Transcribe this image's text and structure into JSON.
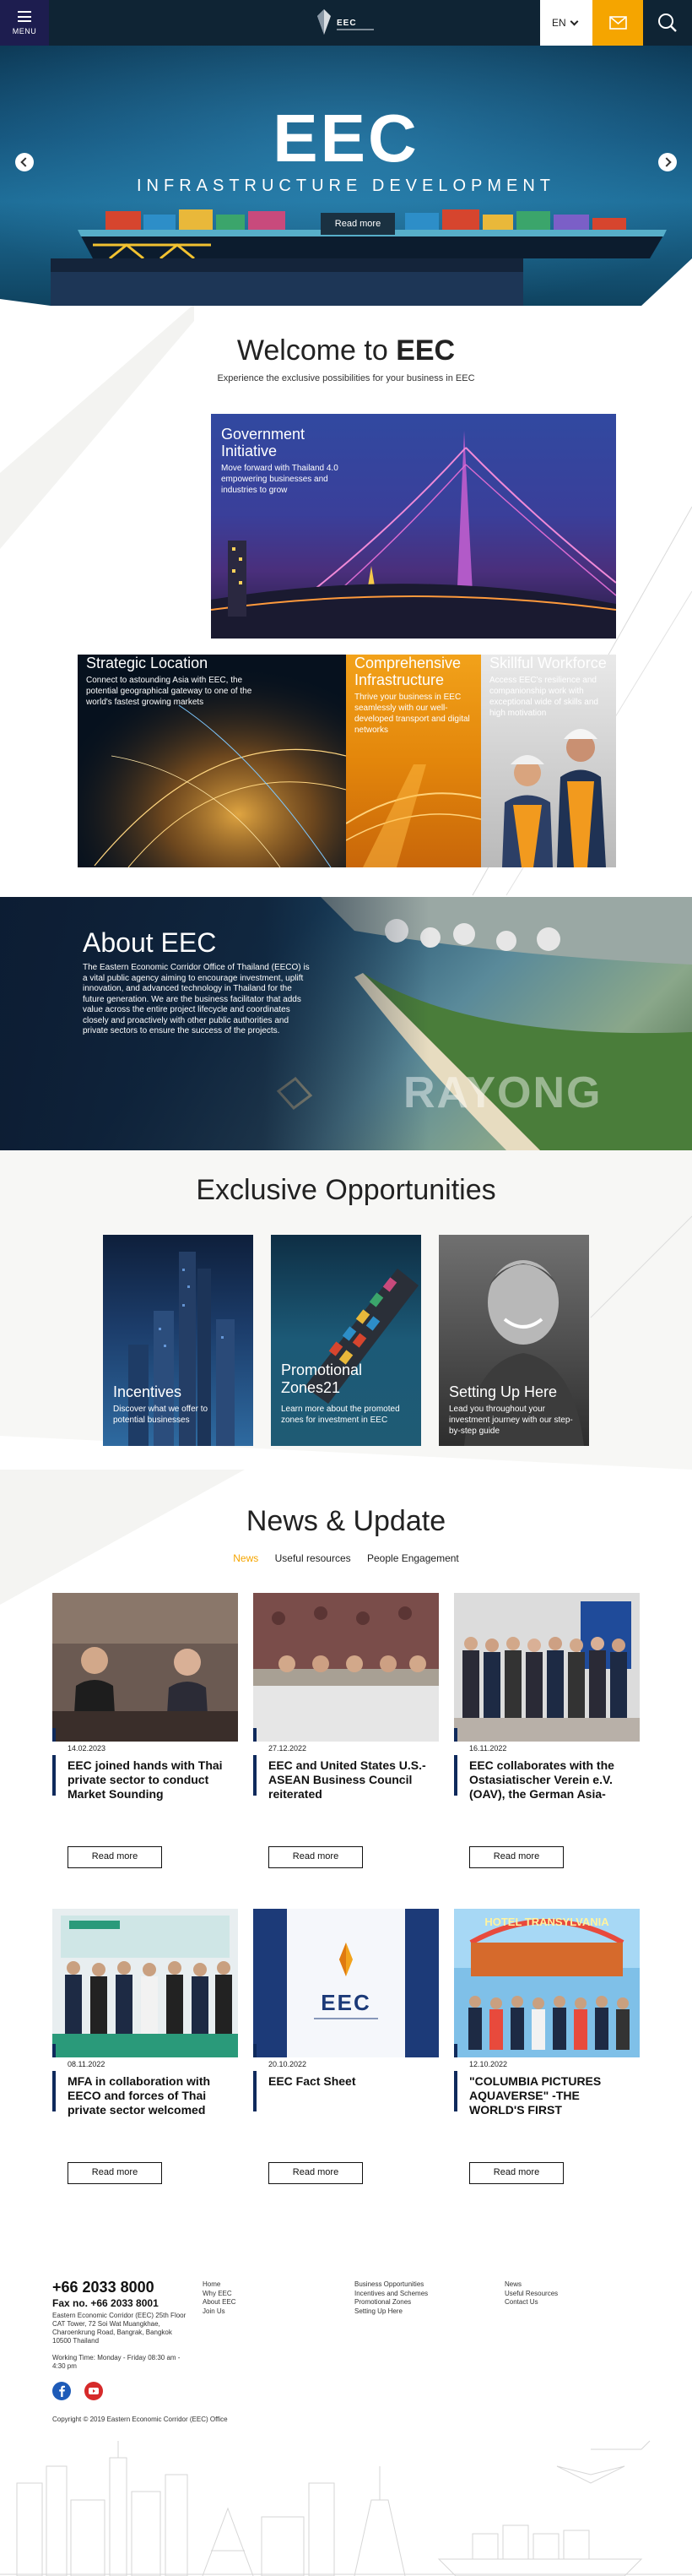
{
  "header": {
    "menu_label": "MENU",
    "logo_text": "EEC",
    "lang": "EN"
  },
  "hero": {
    "title": "EEC",
    "subtitle": "INFRASTRUCTURE DEVELOPMENT",
    "button": "Read more"
  },
  "welcome": {
    "title_plain": "Welcome to ",
    "title_bold": "EEC",
    "subtitle": "Experience the exclusive possibilities for your business in EEC"
  },
  "tiles": {
    "government": {
      "title": "Government Initiative",
      "text": "Move forward with Thailand 4.0 empowering businesses and industries to grow"
    },
    "strategic": {
      "title": "Strategic Location",
      "text": "Connect to astounding Asia with EEC, the potential geographical gateway to one of the world's fastest growing markets"
    },
    "comprehensive": {
      "title": "Comprehensive Infrastructure",
      "text": "Thrive your business in EEC seamlessly with our well-developed transport and digital networks"
    },
    "skillful": {
      "title": "Skillful Workforce",
      "text": "Access EEC's resilience and companionship work with exceptional wide of skills and high motivation"
    }
  },
  "about": {
    "title": "About EEC",
    "text": "The Eastern Economic Corridor Office of Thailand (EECO) is a vital public agency aiming to encourage investment, uplift innovation, and advanced technology in Thailand for the future generation. We are the business facilitator that adds value across the entire project lifecycle and coordinates closely and proactively with other public authorities and private sectors to ensure the success of the projects.",
    "watermark": "RAYONG"
  },
  "exclusive": {
    "title_plain": "Exclusive ",
    "title_bold": "Opportunities",
    "cards": [
      {
        "title": "Incentives",
        "text": "Discover what we offer to potential businesses"
      },
      {
        "title": "Promotional Zones21",
        "text": "Learn more about the promoted zones for investment in EEC"
      },
      {
        "title": "Setting Up Here",
        "text": "Lead you throughout your investment journey with our step-by-step guide"
      }
    ]
  },
  "news": {
    "title_plain": "News & ",
    "title_bold": "Update",
    "tabs": [
      "News",
      "Useful resources",
      "People Engagement"
    ],
    "button": "Read more",
    "items": [
      {
        "date": "14.02.2023",
        "headline": "EEC joined hands with Thai private sector to conduct Market Sounding"
      },
      {
        "date": "27.12.2022",
        "headline": "EEC and United States U.S.-ASEAN Business Council reiterated"
      },
      {
        "date": "16.11.2022",
        "headline": "EEC collaborates with the Ostasiatischer Verein e.V. (OAV), the German Asia-"
      },
      {
        "date": "08.11.2022",
        "headline": "MFA in collaboration with EECO and forces of Thai private sector welcomed"
      },
      {
        "date": "20.10.2022",
        "headline": "EEC Fact Sheet"
      },
      {
        "date": "12.10.2022",
        "headline": "\"COLUMBIA PICTURES AQUAVERSE\" -THE WORLD'S FIRST"
      }
    ],
    "factsheet_logo": "EEC",
    "hotel_sign": "HOTEL TRANSYLVANIA"
  },
  "footer": {
    "phone": "+66 2033 8000",
    "fax": "Fax no. +66 2033 8001",
    "address": "Eastern Economic Corridor (EEC) 25th Floor CAT Tower, 72 Soi Wat Muangkhae, Charoenkrung Road, Bangrak, Bangkok 10500 Thailand",
    "hours": "Working Time: Monday - Friday 08:30 am - 4:30 pm",
    "col1": [
      "Home",
      "Why EEC",
      "About EEC",
      "Join Us"
    ],
    "col2": [
      "Business Opportunities",
      "Incentives and Schemes",
      "Promotional Zones",
      "Setting Up Here"
    ],
    "col3": [
      "News",
      "Useful Resources",
      "Contact Us"
    ],
    "copyright": "Copyright © 2019 Eastern Economic Corridor (EEC) Office"
  },
  "colors": {
    "navy": "#0f2434",
    "accent": "#f5a500",
    "menu": "#1d1d4f"
  }
}
